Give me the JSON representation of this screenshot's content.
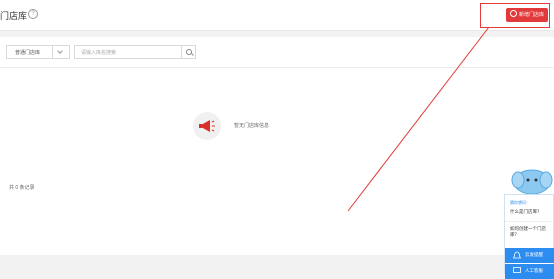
{
  "header": {
    "title": "门店库",
    "help_icon": "?",
    "new_button_label": "新增门店库",
    "accent_color": "#e23a3a"
  },
  "filters": {
    "select_value": "普通门店库",
    "search_placeholder": "请输入库名搜索"
  },
  "empty_state": {
    "icon": "megaphone-icon",
    "text": "暂无门店库信息"
  },
  "footer": {
    "total": "共 0 条记录"
  },
  "chat_widget": {
    "prompt": "猜你想问：",
    "questions": [
      "什么是门店库？",
      "如何创建一个门店库？"
    ],
    "button1": "云发提醒",
    "button2": "人工客服",
    "accent_color": "#2d8cf0"
  }
}
